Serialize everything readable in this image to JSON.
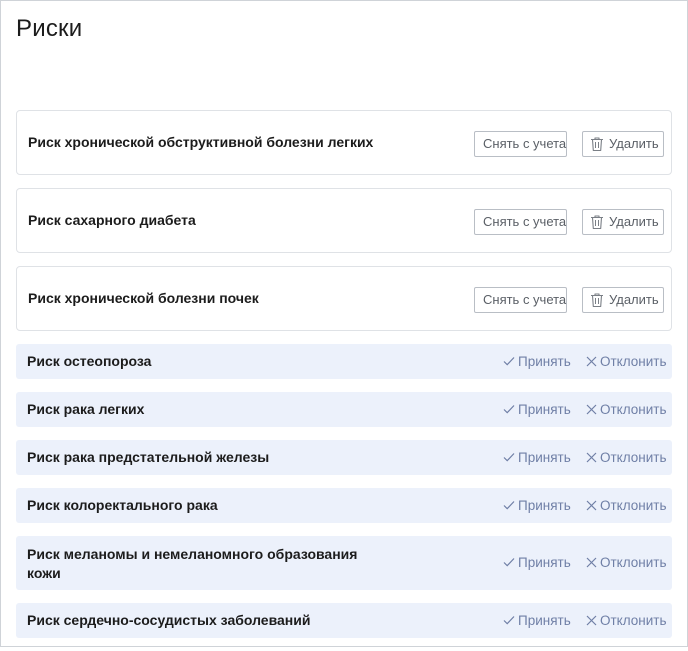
{
  "page": {
    "title": "Риски"
  },
  "buttons": {
    "deregister_label": "Снять с учета",
    "delete_label": "Удалить",
    "accept_label": "Принять",
    "decline_label": "Отклонить"
  },
  "registered_risks": [
    {
      "title": "Риск хронической обструктивной болезни легких"
    },
    {
      "title": "Риск сахарного диабета"
    },
    {
      "title": "Риск хронической болезни почек"
    }
  ],
  "suggested_risks": [
    {
      "title": "Риск остеопороза"
    },
    {
      "title": "Риск рака легких"
    },
    {
      "title": "Риск рака предстательной железы"
    },
    {
      "title": "Риск колоректального рака"
    },
    {
      "title": "Риск меланомы и немеланомного образования кожи"
    },
    {
      "title": "Риск сердечно-сосудистых заболеваний"
    }
  ],
  "icons": {
    "delete": "trash-icon",
    "accept": "check-icon",
    "decline": "close-icon"
  },
  "colors": {
    "suggestion_background": "#ecf1fb",
    "action_text": "#6f7fa6",
    "card_border": "#dfe2e6"
  }
}
